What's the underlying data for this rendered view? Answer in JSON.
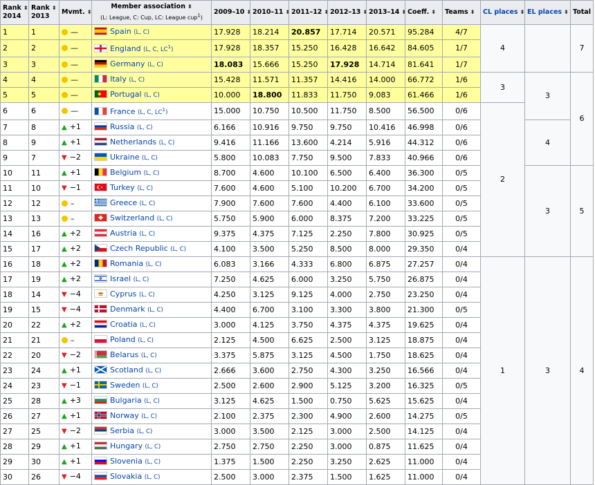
{
  "headers": {
    "rank2014": [
      "Rank",
      "2014"
    ],
    "rank2013": [
      "Rank",
      "2013"
    ],
    "mvmt": "Mvmt.",
    "member": "Member association",
    "member_sub": "(L: League, C: Cup, LC: League cup",
    "member_sup": "1",
    "member_close": ")",
    "y0910": "2009–10",
    "y1011": "2010–11",
    "y1112": "2011–12",
    "y1213": "2012–13",
    "y1314": "2013–14",
    "coeff": "Coeff.",
    "teams": "Teams",
    "cl": "CL places",
    "el": "EL places",
    "total": "Total",
    "sort_glyph": "⬍"
  },
  "rows": [
    {
      "r14": "1",
      "r13": "1",
      "mv": "eq",
      "mvt": "—",
      "country": "Spain",
      "comp": "(L, C)",
      "flag": [
        "#c60b1e",
        "#ffc400",
        "#c60b1e"
      ],
      "flagtype": "h3s",
      "y": [
        "17.928",
        "18.214",
        "20.857",
        "17.714",
        "20.571"
      ],
      "bold": [
        2
      ],
      "coeff": "95.284",
      "teams": "4/7",
      "hl": true
    },
    {
      "r14": "2",
      "r13": "2",
      "mv": "eq",
      "mvt": "—",
      "country": "England",
      "comp": "(L, C, LC",
      "compsup": "1",
      "compclose": ")",
      "flag": [
        "#ffffff",
        "#cf142b"
      ],
      "flagtype": "cross",
      "y": [
        "17.928",
        "18.357",
        "15.250",
        "16.428",
        "16.642"
      ],
      "bold": [],
      "coeff": "84.605",
      "teams": "1/7",
      "hl": true
    },
    {
      "r14": "3",
      "r13": "3",
      "mv": "eq",
      "mvt": "—",
      "country": "Germany",
      "comp": "(L, C)",
      "flag": [
        "#000000",
        "#dd0000",
        "#ffce00"
      ],
      "flagtype": "h3",
      "y": [
        "18.083",
        "15.666",
        "15.250",
        "17.928",
        "14.714"
      ],
      "bold": [
        0,
        3
      ],
      "coeff": "81.641",
      "teams": "1/7",
      "hl": true
    },
    {
      "r14": "4",
      "r13": "4",
      "mv": "eq",
      "mvt": "—",
      "country": "Italy",
      "comp": "(L, C)",
      "flag": [
        "#009246",
        "#ffffff",
        "#ce2b37"
      ],
      "flagtype": "v3",
      "y": [
        "15.428",
        "11.571",
        "11.357",
        "14.416",
        "14.000"
      ],
      "bold": [],
      "coeff": "66.772",
      "teams": "1/6",
      "hl": true
    },
    {
      "r14": "5",
      "r13": "5",
      "mv": "eq",
      "mvt": "—",
      "country": "Portugal",
      "comp": "(L, C)",
      "flag": [
        "#006600",
        "#ff0000"
      ],
      "flagtype": "v2",
      "y": [
        "10.000",
        "18.800",
        "11.833",
        "11.750",
        "9.083"
      ],
      "bold": [
        1
      ],
      "coeff": "61.466",
      "teams": "1/6",
      "hl": true
    },
    {
      "r14": "6",
      "r13": "6",
      "mv": "eq",
      "mvt": "—",
      "country": "France",
      "comp": "(L, C, LC",
      "compsup": "1",
      "compclose": ")",
      "flag": [
        "#0055a4",
        "#ffffff",
        "#ef4135"
      ],
      "flagtype": "v3",
      "y": [
        "15.000",
        "10.750",
        "10.500",
        "11.750",
        "8.500"
      ],
      "bold": [],
      "coeff": "56.500",
      "teams": "0/6",
      "hl": false
    },
    {
      "r14": "7",
      "r13": "8",
      "mv": "up",
      "mvt": "+1",
      "country": "Russia",
      "comp": "(L, C)",
      "flag": [
        "#ffffff",
        "#0039a6",
        "#d52b1e"
      ],
      "flagtype": "h3",
      "y": [
        "6.166",
        "10.916",
        "9.750",
        "9.750",
        "10.416"
      ],
      "bold": [],
      "coeff": "46.998",
      "teams": "0/6",
      "hl": false
    },
    {
      "r14": "8",
      "r13": "9",
      "mv": "up",
      "mvt": "+1",
      "country": "Netherlands",
      "comp": "(L, C)",
      "flag": [
        "#ae1c28",
        "#ffffff",
        "#21468b"
      ],
      "flagtype": "h3",
      "y": [
        "9.416",
        "11.166",
        "13.600",
        "4.214",
        "5.916"
      ],
      "bold": [],
      "coeff": "44.312",
      "teams": "0/6",
      "hl": false
    },
    {
      "r14": "9",
      "r13": "7",
      "mv": "down",
      "mvt": "−2",
      "country": "Ukraine",
      "comp": "(L, C)",
      "flag": [
        "#0057b7",
        "#ffd700"
      ],
      "flagtype": "h2",
      "y": [
        "5.800",
        "10.083",
        "7.750",
        "9.500",
        "7.833"
      ],
      "bold": [],
      "coeff": "40.966",
      "teams": "0/6",
      "hl": false
    },
    {
      "r14": "10",
      "r13": "11",
      "mv": "up",
      "mvt": "+1",
      "country": "Belgium",
      "comp": "(L, C)",
      "flag": [
        "#000000",
        "#fdda24",
        "#ef3340"
      ],
      "flagtype": "v3",
      "y": [
        "8.700",
        "4.600",
        "10.100",
        "6.500",
        "6.400"
      ],
      "bold": [],
      "coeff": "36.300",
      "teams": "0/5",
      "hl": false
    },
    {
      "r14": "11",
      "r13": "10",
      "mv": "down",
      "mvt": "−1",
      "country": "Turkey",
      "comp": "(L, C)",
      "flag": [
        "#e30a17",
        "#ffffff"
      ],
      "flagtype": "crescent",
      "y": [
        "7.600",
        "4.600",
        "5.100",
        "10.200",
        "6.700"
      ],
      "bold": [],
      "coeff": "34.200",
      "teams": "0/5",
      "hl": false
    },
    {
      "r14": "12",
      "r13": "12",
      "mv": "eq",
      "mvt": "–",
      "country": "Greece",
      "comp": "(L, C)",
      "flag": [
        "#0d5eaf",
        "#ffffff"
      ],
      "flagtype": "stripes",
      "y": [
        "7.900",
        "7.600",
        "7.600",
        "4.400",
        "6.100"
      ],
      "bold": [],
      "coeff": "33.600",
      "teams": "0/5",
      "hl": false
    },
    {
      "r14": "13",
      "r13": "13",
      "mv": "eq",
      "mvt": "–",
      "country": "Switzerland",
      "comp": "(L, C)",
      "flag": [
        "#d52b1e",
        "#ffffff"
      ],
      "flagtype": "swiss",
      "y": [
        "5.750",
        "5.900",
        "6.000",
        "8.375",
        "7.200"
      ],
      "bold": [],
      "coeff": "33.225",
      "teams": "0/5",
      "hl": false
    },
    {
      "r14": "14",
      "r13": "16",
      "mv": "up",
      "mvt": "+2",
      "country": "Austria",
      "comp": "(L, C)",
      "flag": [
        "#ed2939",
        "#ffffff",
        "#ed2939"
      ],
      "flagtype": "h3",
      "y": [
        "9.375",
        "4.375",
        "7.125",
        "2.250",
        "7.800"
      ],
      "bold": [],
      "coeff": "30.925",
      "teams": "0/5",
      "hl": false
    },
    {
      "r14": "15",
      "r13": "17",
      "mv": "up",
      "mvt": "+2",
      "country": "Czech Republic",
      "comp": "(L, C)",
      "flag": [
        "#ffffff",
        "#d7141a",
        "#11457e"
      ],
      "flagtype": "czech",
      "y": [
        "4.100",
        "3.500",
        "5.250",
        "8.500",
        "8.000"
      ],
      "bold": [],
      "coeff": "29.350",
      "teams": "0/4",
      "hl": false
    },
    {
      "r14": "16",
      "r13": "18",
      "mv": "up",
      "mvt": "+2",
      "country": "Romania",
      "comp": "(L, C)",
      "flag": [
        "#002b7f",
        "#fcd116",
        "#ce1126"
      ],
      "flagtype": "v3",
      "y": [
        "6.083",
        "3.166",
        "4.333",
        "6.800",
        "6.875"
      ],
      "bold": [],
      "coeff": "27.257",
      "teams": "0/4",
      "hl": false
    },
    {
      "r14": "17",
      "r13": "19",
      "mv": "up",
      "mvt": "+2",
      "country": "Israel",
      "comp": "(L, C)",
      "flag": [
        "#ffffff",
        "#0038b8"
      ],
      "flagtype": "israel",
      "y": [
        "7.250",
        "4.625",
        "6.000",
        "3.250",
        "5.750"
      ],
      "bold": [],
      "coeff": "26.875",
      "teams": "0/4",
      "hl": false
    },
    {
      "r14": "18",
      "r13": "14",
      "mv": "down",
      "mvt": "−4",
      "country": "Cyprus",
      "comp": "(L, C)",
      "flag": [
        "#ffffff",
        "#d57800"
      ],
      "flagtype": "cyprus",
      "y": [
        "4.250",
        "3.125",
        "9.125",
        "4.000",
        "2.750"
      ],
      "bold": [],
      "coeff": "23.250",
      "teams": "0/4",
      "hl": false
    },
    {
      "r14": "19",
      "r13": "15",
      "mv": "down",
      "mvt": "−4",
      "country": "Denmark",
      "comp": "(L, C)",
      "flag": [
        "#c60c30",
        "#ffffff"
      ],
      "flagtype": "nordic",
      "y": [
        "4.400",
        "6.700",
        "3.100",
        "3.300",
        "3.800"
      ],
      "bold": [],
      "coeff": "21.300",
      "teams": "0/5",
      "hl": false
    },
    {
      "r14": "20",
      "r13": "22",
      "mv": "up",
      "mvt": "+2",
      "country": "Croatia",
      "comp": "(L, C)",
      "flag": [
        "#ff0000",
        "#ffffff",
        "#171796"
      ],
      "flagtype": "h3",
      "y": [
        "3.000",
        "4.125",
        "3.750",
        "4.375",
        "4.375"
      ],
      "bold": [],
      "coeff": "19.625",
      "teams": "0/4",
      "hl": false
    },
    {
      "r14": "21",
      "r13": "21",
      "mv": "eq",
      "mvt": "–",
      "country": "Poland",
      "comp": "(L, C)",
      "flag": [
        "#ffffff",
        "#dc143c"
      ],
      "flagtype": "h2",
      "y": [
        "2.125",
        "4.500",
        "6.625",
        "2.500",
        "3.125"
      ],
      "bold": [],
      "coeff": "18.875",
      "teams": "0/4",
      "hl": false
    },
    {
      "r14": "22",
      "r13": "20",
      "mv": "down",
      "mvt": "−2",
      "country": "Belarus",
      "comp": "(L, C)",
      "flag": [
        "#c8313e",
        "#4aa657"
      ],
      "flagtype": "belarus",
      "y": [
        "3.375",
        "5.875",
        "3.125",
        "4.500",
        "1.750"
      ],
      "bold": [],
      "coeff": "18.625",
      "teams": "0/4",
      "hl": false
    },
    {
      "r14": "23",
      "r13": "24",
      "mv": "up",
      "mvt": "+1",
      "country": "Scotland",
      "comp": "(L, C)",
      "flag": [
        "#005eb8",
        "#ffffff"
      ],
      "flagtype": "saltire",
      "y": [
        "2.666",
        "3.600",
        "2.750",
        "4.300",
        "3.250"
      ],
      "bold": [],
      "coeff": "16.566",
      "teams": "0/4",
      "hl": false
    },
    {
      "r14": "24",
      "r13": "23",
      "mv": "down",
      "mvt": "−1",
      "country": "Sweden",
      "comp": "(L, C)",
      "flag": [
        "#006aa7",
        "#fecc00"
      ],
      "flagtype": "nordic",
      "y": [
        "2.500",
        "2.600",
        "2.900",
        "5.125",
        "3.200"
      ],
      "bold": [],
      "coeff": "16.325",
      "teams": "0/5",
      "hl": false
    },
    {
      "r14": "25",
      "r13": "28",
      "mv": "up",
      "mvt": "+3",
      "country": "Bulgaria",
      "comp": "(L, C)",
      "flag": [
        "#ffffff",
        "#00966e",
        "#d62612"
      ],
      "flagtype": "h3",
      "y": [
        "3.125",
        "4.625",
        "1.500",
        "0.750",
        "5.625"
      ],
      "bold": [],
      "coeff": "15.625",
      "teams": "0/4",
      "hl": false
    },
    {
      "r14": "26",
      "r13": "27",
      "mv": "up",
      "mvt": "+1",
      "country": "Norway",
      "comp": "(L, C)",
      "flag": [
        "#ba0c2f",
        "#ffffff",
        "#00205b"
      ],
      "flagtype": "norway",
      "y": [
        "2.100",
        "2.375",
        "2.300",
        "4.900",
        "2.600"
      ],
      "bold": [],
      "coeff": "14.275",
      "teams": "0/5",
      "hl": false
    },
    {
      "r14": "27",
      "r13": "25",
      "mv": "down",
      "mvt": "−2",
      "country": "Serbia",
      "comp": "(L, C)",
      "flag": [
        "#c6363c",
        "#0c4076",
        "#ffffff"
      ],
      "flagtype": "h3",
      "y": [
        "3.000",
        "3.500",
        "2.125",
        "3.000",
        "2.500"
      ],
      "bold": [],
      "coeff": "14.125",
      "teams": "0/4",
      "hl": false
    },
    {
      "r14": "28",
      "r13": "29",
      "mv": "up",
      "mvt": "+1",
      "country": "Hungary",
      "comp": "(L, C)",
      "flag": [
        "#ce2939",
        "#ffffff",
        "#477050"
      ],
      "flagtype": "h3",
      "y": [
        "2.750",
        "2.750",
        "2.250",
        "3.000",
        "0.875"
      ],
      "bold": [],
      "coeff": "11.625",
      "teams": "0/4",
      "hl": false
    },
    {
      "r14": "29",
      "r13": "30",
      "mv": "up",
      "mvt": "+1",
      "country": "Slovenia",
      "comp": "(L, C)",
      "flag": [
        "#ffffff",
        "#0000ff",
        "#ff0000"
      ],
      "flagtype": "h3",
      "y": [
        "1.375",
        "1.500",
        "2.250",
        "3.250",
        "2.625"
      ],
      "bold": [],
      "coeff": "11.000",
      "teams": "0/4",
      "hl": false
    },
    {
      "r14": "30",
      "r13": "26",
      "mv": "down",
      "mvt": "−4",
      "country": "Slovakia",
      "comp": "(L, C)",
      "flag": [
        "#ffffff",
        "#0b4ea2",
        "#ee1c25"
      ],
      "flagtype": "h3",
      "y": [
        "2.500",
        "3.000",
        "2.375",
        "1.500",
        "1.625"
      ],
      "bold": [],
      "coeff": "11.000",
      "teams": "0/4",
      "hl": false
    }
  ],
  "groups": {
    "cl": [
      {
        "start": 0,
        "span": 3,
        "label": "4"
      },
      {
        "start": 3,
        "span": 2,
        "label": "3"
      },
      {
        "start": 5,
        "span": 10,
        "label": "2"
      },
      {
        "start": 15,
        "span": 15,
        "label": "1"
      }
    ],
    "el": [
      {
        "start": 0,
        "span": 3,
        "label": ""
      },
      {
        "start": 3,
        "span": 3,
        "label": "3"
      },
      {
        "start": 6,
        "span": 3,
        "label": "4"
      },
      {
        "start": 9,
        "span": 6,
        "label": "3"
      },
      {
        "start": 15,
        "span": 15,
        "label": "3"
      }
    ],
    "el_top_label": "3",
    "total": [
      {
        "start": 0,
        "span": 3,
        "label": "7"
      },
      {
        "start": 3,
        "span": 6,
        "label": "6"
      },
      {
        "start": 9,
        "span": 6,
        "label": "5"
      },
      {
        "start": 15,
        "span": 15,
        "label": "4"
      }
    ]
  }
}
